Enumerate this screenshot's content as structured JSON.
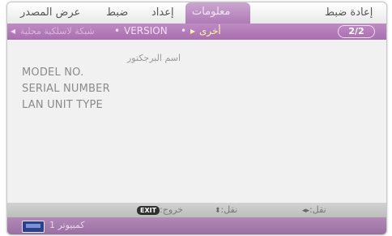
{
  "tabs": {
    "source_display": "عرض المصدر",
    "adjust": "ضبط",
    "setup": "إعداد",
    "info": "معلومات",
    "reset": "إعادة ضبط"
  },
  "subtabs": {
    "wireless_lan": "شبكة لاسلكية محلية",
    "version": "VERSION",
    "others": "أخرى",
    "page_indicator": "2/2"
  },
  "content": {
    "projector_name": "اسم البرجكتور",
    "model_no": "MODEL NO.",
    "serial_number": "SERIAL NUMBER",
    "lan_unit_type": "LAN UNIT TYPE"
  },
  "help": {
    "exit_key": "EXIT",
    "exit_label": ":خروج",
    "move_vertical_label": ":نقل",
    "move_horizontal_label": ":نقل"
  },
  "status": {
    "source": "كمبيوتر 1"
  },
  "colors": {
    "accent": "#b07cb7",
    "highlight": "#fff7a8",
    "text_gray": "#8a8a8a"
  }
}
